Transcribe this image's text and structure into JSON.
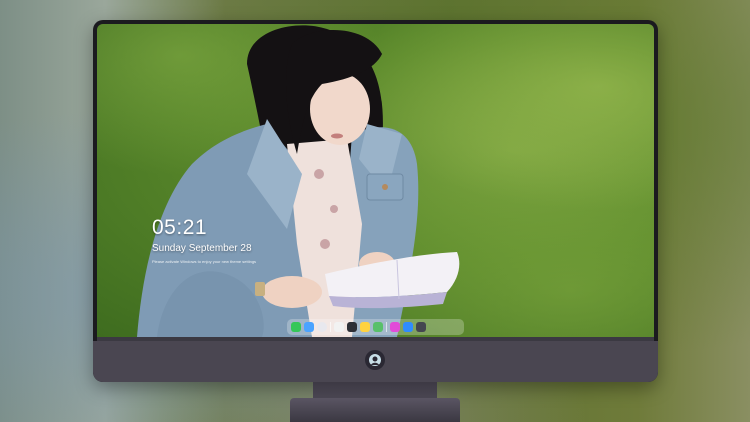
{
  "lockscreen": {
    "time": "05:21",
    "date": "Sunday September  28",
    "notice": "Please activate Windows to enjoy your new theme settings"
  },
  "dock": {
    "apps": [
      {
        "name": "messages-icon",
        "color": "#34c759"
      },
      {
        "name": "finder-icon",
        "color": "#4aa3ff"
      },
      {
        "name": "safari-icon",
        "color": "#e8e8ee"
      },
      {
        "name": "notes-app-icon",
        "color": "#f2f2f2"
      },
      {
        "name": "photos-icon",
        "color": "#ffd23f"
      },
      {
        "name": "maps-icon",
        "color": "#58c06a"
      },
      {
        "name": "calendar-icon",
        "color": "#f5f5f5"
      },
      {
        "name": "itunes-icon",
        "color": "#e24bd8"
      },
      {
        "name": "app-store-icon",
        "color": "#2f8cff"
      },
      {
        "name": "system-icon",
        "color": "#444650"
      }
    ]
  },
  "colors": {
    "bezel": "#1b1a1f",
    "chin": "#4a4651",
    "grass": "#5c8a2c"
  }
}
